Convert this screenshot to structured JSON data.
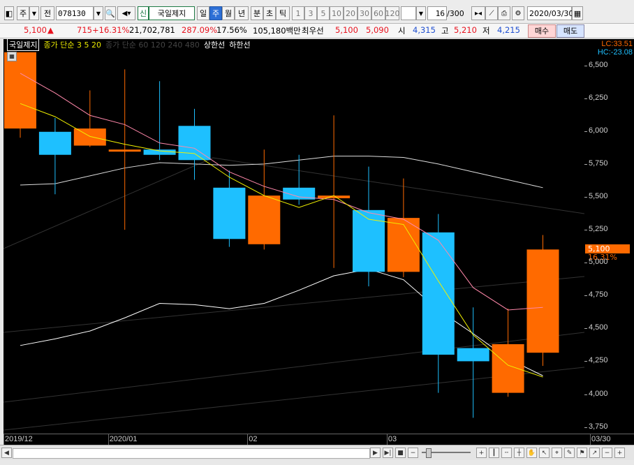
{
  "toolbar": {
    "market_type": "주",
    "prev_label": "전",
    "code": "078130",
    "new_badge": "신",
    "stock_name": "국일제지",
    "periods": [
      "일",
      "주",
      "월",
      "년"
    ],
    "period_active": "주",
    "minute_tick": [
      "분",
      "초",
      "틱"
    ],
    "intervals": [
      "1",
      "3",
      "5",
      "10",
      "20",
      "30",
      "60",
      "120"
    ],
    "count_value": "16",
    "count_max": "/300",
    "date": "2020/03/30"
  },
  "quote": {
    "price": "5,100",
    "arrow": "▲",
    "change": "715",
    "change_pct": "+16.31%",
    "volume": "21,702,781",
    "volume_ratio": "287.09%",
    "turnover": "17.56%",
    "amount": "105,180백만",
    "bid_label": "최우선",
    "ask": "5,100",
    "bid": "5,090",
    "open_label": "시",
    "open": "4,315",
    "high_label": "고",
    "high": "5,210",
    "low_label": "저",
    "low": "4,215",
    "buy_label": "매수",
    "sell_label": "매도"
  },
  "legend": {
    "stock": "국일제지",
    "ma_label": "종가 단순 3  5  20",
    "ma_long": "종가 단순 60  120  240  480",
    "limit_up": "상한선",
    "limit_down": "하한선"
  },
  "axis_info": {
    "lc": "LC:33.51",
    "hc": "HC:-23.08",
    "current_price": "5,100",
    "current_pct": "16.31%"
  },
  "colors": {
    "up": "#ff6a00",
    "down": "#1ec0ff",
    "ma3": "#f0f000",
    "ma5": "#ff88aa",
    "ma20": "#ffffff"
  },
  "chart_data": {
    "type": "candlestick",
    "title": "",
    "ylim": [
      3700,
      6700
    ],
    "yticks": [
      3750,
      4000,
      4250,
      4500,
      4750,
      5000,
      5250,
      5500,
      5750,
      6000,
      6250,
      6500
    ],
    "ytick_labels": [
      "3,750",
      "4,000",
      "4,250",
      "4,500",
      "4,750",
      "5,000",
      "5,250",
      "5,500",
      "5,750",
      "6,000",
      "6,250",
      "6,500"
    ],
    "x_labels": [
      {
        "label": "2019/12",
        "index": 0
      },
      {
        "label": "2020/01",
        "index": 3
      },
      {
        "label": "02",
        "index": 7
      },
      {
        "label": "03",
        "index": 11
      },
      {
        "label": "03/30",
        "index": 15
      }
    ],
    "candles": [
      {
        "open": 6020,
        "high": 6440,
        "low": 5950,
        "close": 6600
      },
      {
        "open": 5995,
        "high": 6100,
        "low": 5520,
        "close": 5820
      },
      {
        "open": 5890,
        "high": 6310,
        "low": 5880,
        "close": 6020
      },
      {
        "open": 5850,
        "high": 6470,
        "low": 5250,
        "close": 5860
      },
      {
        "open": 5860,
        "high": 6380,
        "low": 5780,
        "close": 5820
      },
      {
        "open": 6040,
        "high": 6170,
        "low": 5630,
        "close": 5780
      },
      {
        "open": 5570,
        "high": 5700,
        "low": 5120,
        "close": 5180
      },
      {
        "open": 5140,
        "high": 5860,
        "low": 5100,
        "close": 5510
      },
      {
        "open": 5570,
        "high": 5820,
        "low": 5440,
        "close": 5480
      },
      {
        "open": 5490,
        "high": 6120,
        "low": 4960,
        "close": 5510
      },
      {
        "open": 5400,
        "high": 5730,
        "low": 4820,
        "close": 4930
      },
      {
        "open": 4930,
        "high": 5640,
        "low": 4890,
        "close": 5340
      },
      {
        "open": 5230,
        "high": 5370,
        "low": 4010,
        "close": 4300
      },
      {
        "open": 4350,
        "high": 4660,
        "low": 3820,
        "close": 4250
      },
      {
        "open": 4010,
        "high": 4650,
        "low": 3980,
        "close": 4380
      },
      {
        "open": 4315,
        "high": 5210,
        "low": 4215,
        "close": 5100
      }
    ],
    "ma3": [
      6210,
      6110,
      5960,
      5900,
      5850,
      5830,
      5650,
      5510,
      5420,
      5510,
      5330,
      5290,
      4860,
      4450,
      4220,
      4130
    ],
    "ma5": [
      6440,
      6290,
      6120,
      6050,
      5910,
      5870,
      5690,
      5580,
      5500,
      5480,
      5380,
      5330,
      5170,
      4810,
      4640,
      4660
    ],
    "ma20": [
      4370,
      4420,
      4480,
      4580,
      4690,
      4680,
      4650,
      4690,
      4790,
      4900,
      4950,
      4870,
      4640,
      4460,
      4270,
      4140
    ],
    "ma60": [
      5590,
      5600,
      5660,
      5720,
      5760,
      5750,
      5740,
      5750,
      5780,
      5810,
      5810,
      5800,
      5750,
      5690,
      5630,
      5570
    ]
  }
}
